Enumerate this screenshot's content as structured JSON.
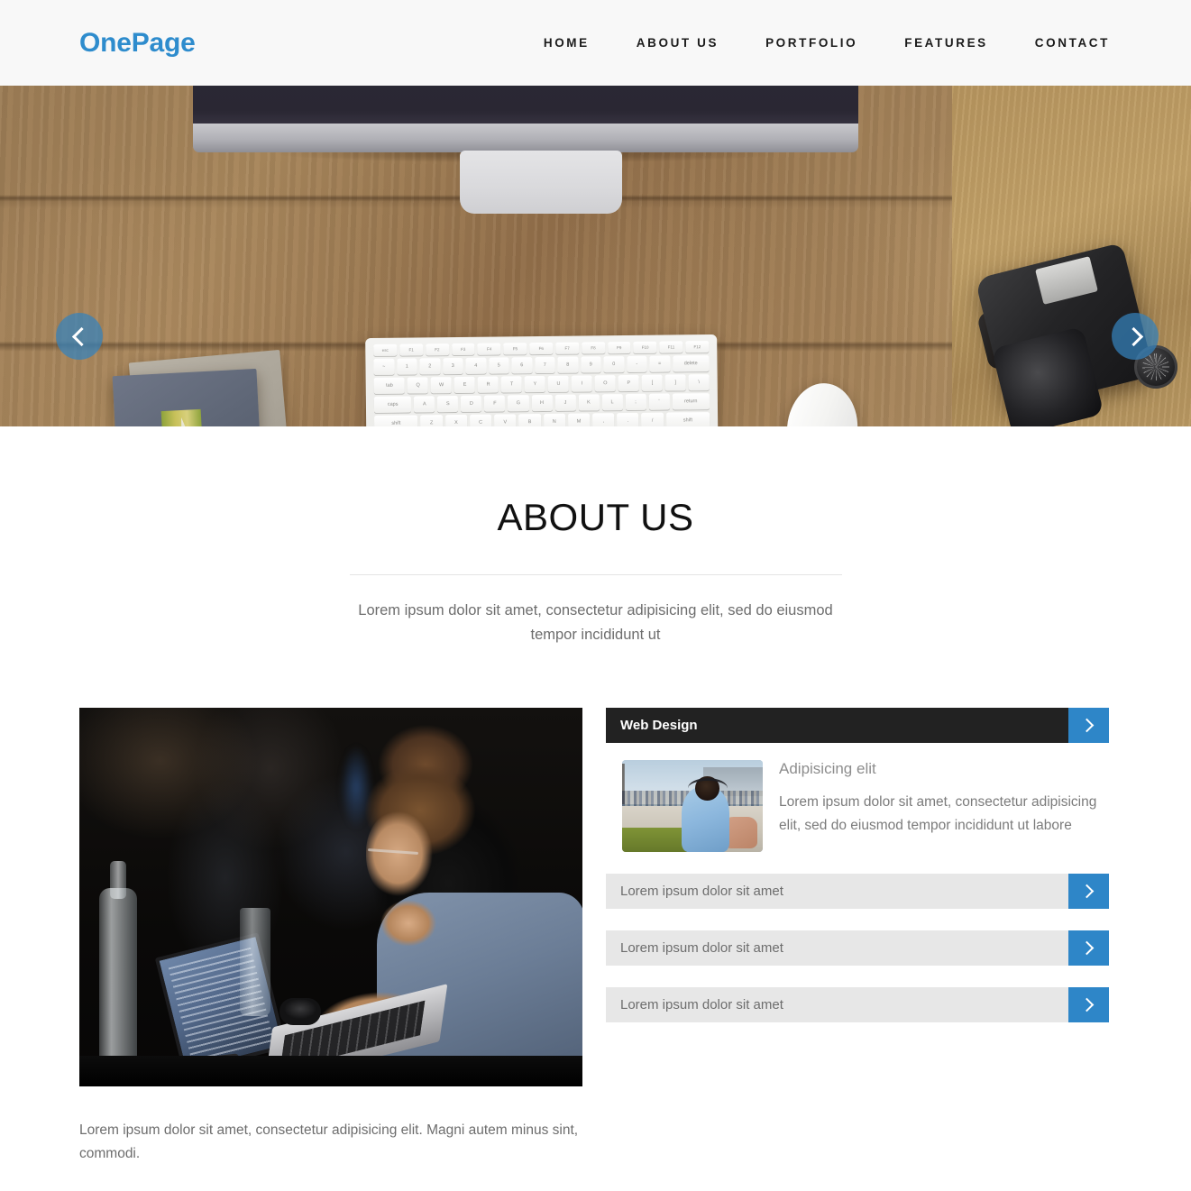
{
  "header": {
    "brand": "OnePage",
    "brand_color": "#2e8ccd",
    "nav": [
      {
        "label": "HOME"
      },
      {
        "label": "ABOUT US"
      },
      {
        "label": "PORTFOLIO"
      },
      {
        "label": "FEATURES"
      },
      {
        "label": "CONTACT"
      }
    ]
  },
  "hero": {
    "prev_icon": "chevron-left-icon",
    "next_icon": "chevron-right-icon",
    "image_alt": "Wooden desk top-down with iMac, keyboard, mouse, notebooks and DSLR camera"
  },
  "about": {
    "title": "ABOUT US",
    "subtitle": "Lorem ipsum dolor sit amet, consectetur adipisicing elit, sed do eiusmod tempor incididunt ut"
  },
  "content": {
    "photo_alt": "Two developers working on laptops at a conference table",
    "caption": "Lorem ipsum dolor sit amet, consectetur adipisicing elit. Magni autem minus sint, commodi."
  },
  "accordion": {
    "toggle_icon": "chevron-right-icon",
    "accent_color": "#2e86c8",
    "open_header_bg": "#222222",
    "closed_header_bg": "#e7e7e7",
    "items": [
      {
        "title": "Web Design",
        "open": true,
        "body_heading": "Adipisicing elit",
        "body_text": "Lorem ipsum dolor sit amet, consectetur adipisicing elit, sed do eiusmod tempor incididunt ut labore",
        "thumb_alt": "Person with headphones sitting outdoors by a plaza"
      },
      {
        "title": "Lorem ipsum dolor sit amet",
        "open": false
      },
      {
        "title": "Lorem ipsum dolor sit amet",
        "open": false
      },
      {
        "title": "Lorem ipsum dolor sit amet",
        "open": false
      }
    ]
  }
}
